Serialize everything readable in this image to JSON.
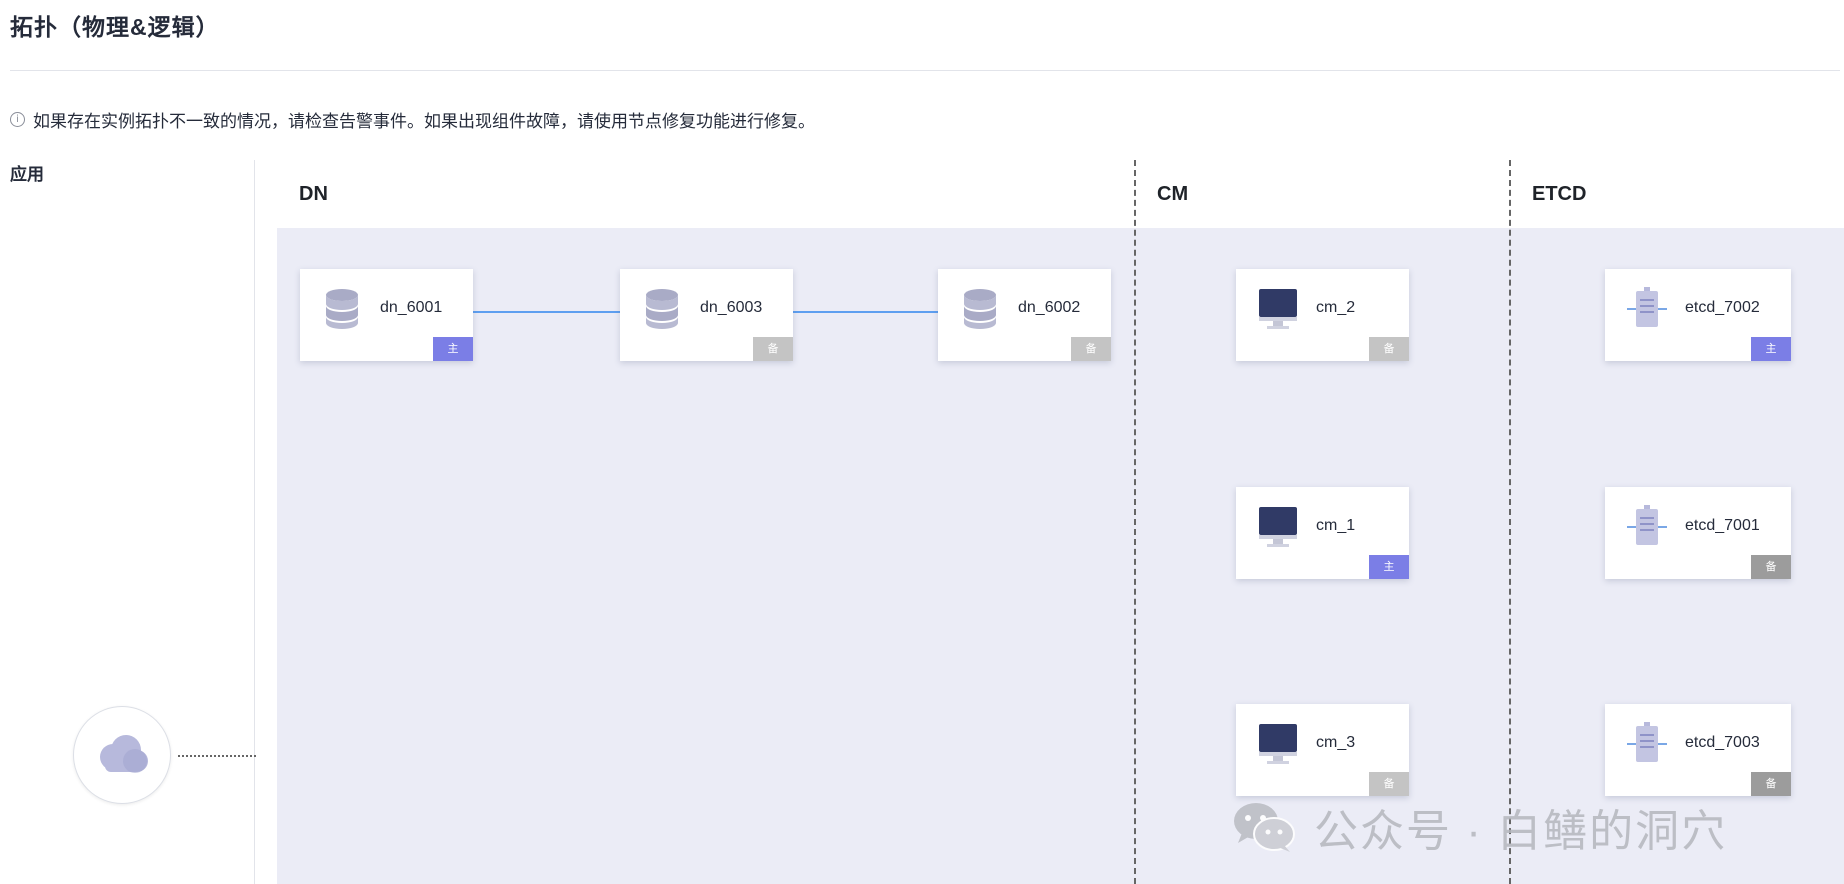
{
  "page": {
    "title": "拓扑（物理&逻辑）"
  },
  "notice": {
    "icon": "info-icon",
    "text": "如果存在实例拓扑不一致的情况，请检查告警事件。如果出现组件故障，请使用节点修复功能进行修复。"
  },
  "app": {
    "label": "应用",
    "icon": "cloud-icon"
  },
  "lanes": [
    {
      "title": "DN"
    },
    {
      "title": "CM"
    },
    {
      "title": "ETCD"
    }
  ],
  "roles": {
    "primary": "主",
    "standby": "备"
  },
  "dn_nodes": [
    {
      "name": "dn_6001",
      "role": "primary"
    },
    {
      "name": "dn_6003",
      "role": "standby"
    },
    {
      "name": "dn_6002",
      "role": "standby"
    }
  ],
  "cm_nodes": [
    {
      "name": "cm_2",
      "role": "standby"
    },
    {
      "name": "cm_1",
      "role": "primary"
    },
    {
      "name": "cm_3",
      "role": "standby"
    }
  ],
  "etcd_nodes": [
    {
      "name": "etcd_7002",
      "role": "primary"
    },
    {
      "name": "etcd_7001",
      "role": "standby"
    },
    {
      "name": "etcd_7003",
      "role": "standby"
    }
  ],
  "watermark": {
    "icon": "wechat-icon",
    "text": "公众号 · 白鳝的洞穴"
  },
  "colors": {
    "primary_badge": "#7b7ee6",
    "standby_badge": "#c4c4c4",
    "canvas_bg": "#ebecf6",
    "link": "#5e9ff0"
  }
}
